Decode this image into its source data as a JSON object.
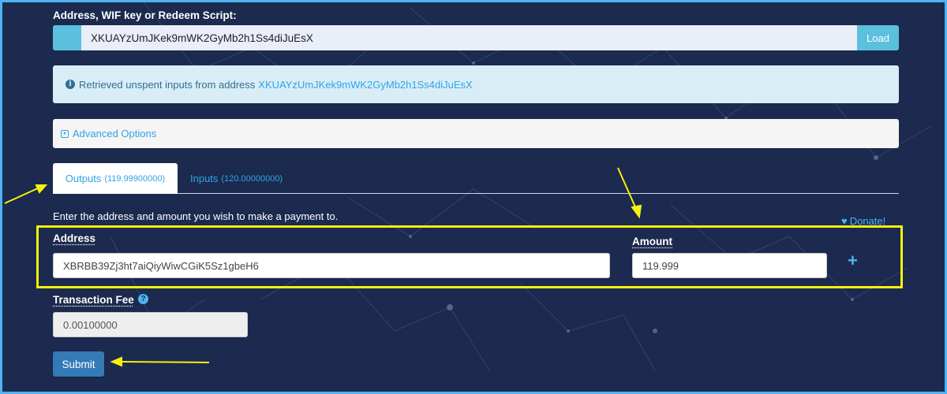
{
  "form": {
    "address_label": "Address, WIF key or Redeem Script:",
    "address_value": "XKUAYzUmJKek9mWK2GyMb2h1Ss4diJuEsX",
    "load_label": "Load"
  },
  "info": {
    "text": "Retrieved unspent inputs from address",
    "link": "XKUAYzUmJKek9mWK2GyMb2h1Ss4diJuEsX"
  },
  "advanced": {
    "label": "Advanced Options"
  },
  "tabs": [
    {
      "label": "Outputs",
      "count": "(119.99900000)",
      "active": true
    },
    {
      "label": "Inputs",
      "count": "(120.00000000)",
      "active": false
    }
  ],
  "outputs": {
    "instruction": "Enter the address and amount you wish to make a payment to.",
    "donate_label": "Donate!",
    "address_label": "Address",
    "amount_label": "Amount",
    "address_value": "XBRBB39Zj3ht7aiQiyWiwCGiK5Sz1gbeH6",
    "amount_value": "119.999",
    "add_symbol": "+"
  },
  "fee": {
    "label": "Transaction Fee",
    "help_symbol": "?",
    "value": "0.00100000"
  },
  "submit_label": "Submit",
  "colors": {
    "background": "#1b2a4e",
    "accent": "#5bc0de",
    "link": "#2fa4e7",
    "highlight": "#f6f00f",
    "button": "#337ab7"
  },
  "icons": [
    "info-icon",
    "caret-icon",
    "heart-icon",
    "plus-icon",
    "help-icon"
  ]
}
